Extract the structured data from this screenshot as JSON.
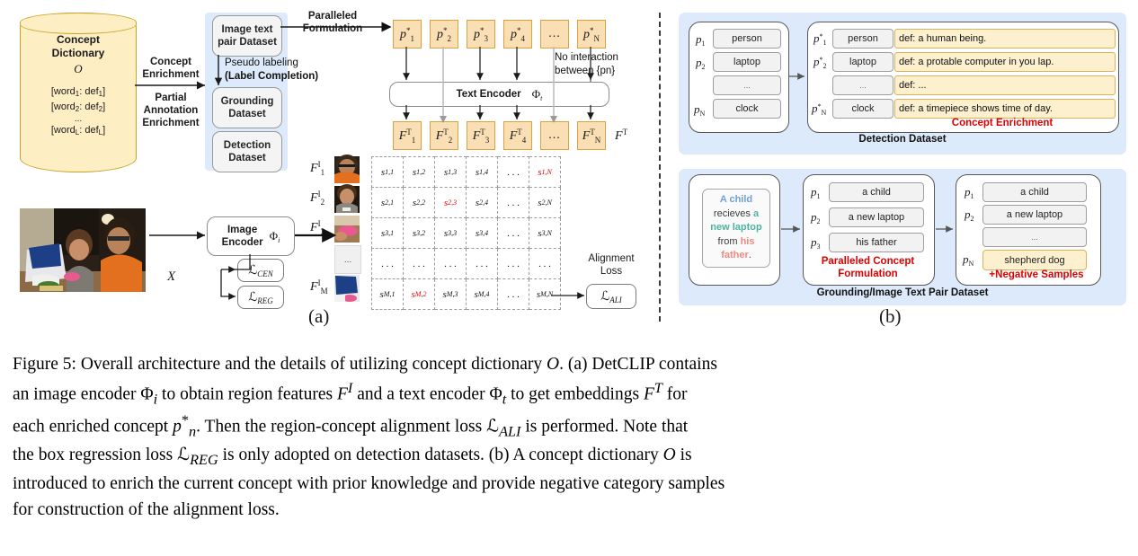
{
  "figure": {
    "label_a": "(a)",
    "label_b": "(b)",
    "caption_line1": "Figure 5: Overall architecture and the details of utilizing concept dictionary O. (a) DetCLIP contains",
    "caption_line2": "an image encoder Φi to obtain region features F I and a text encoder Φt to get embeddings F T for",
    "caption_line3": "each enriched concept p*n. Then the region-concept alignment loss LALI is performed. Note that",
    "caption_line4": "the box regression loss LREG is only adopted on detection datasets. (b) A concept dictionary O is",
    "caption_line5": "introduced to enrich the current concept with prior knowledge and provide negative category samples",
    "caption_line6": "for construction of the alignment loss."
  },
  "colors": {
    "dict_fill": "#fdeec4",
    "dict_stroke": "#c9a227",
    "panel_blue": "#ddeafb",
    "token_fill": "#fbdfb4",
    "token_stroke": "#d9a13f",
    "def_fill": "#fdf0cf",
    "accent_red": "#e00000",
    "phrase_blue": "#6f9fd8",
    "phrase_teal": "#4fb3a0",
    "phrase_red": "#f08a80"
  },
  "panel_a": {
    "dictionary": {
      "title_line1": "Concept",
      "title_line2": "Dictionary",
      "symbol": "O",
      "entry1": "[word1: def1]",
      "entry2": "[word2: def2]",
      "ellipsis": "...",
      "entryL": "[wordL: defL]"
    },
    "arrow_labels": {
      "concept_enrichment_l1": "Concept",
      "concept_enrichment_l2": "Enrichment",
      "partial_l1": "Partial",
      "partial_l2": "Annotation",
      "partial_l3": "Enrichment",
      "paralleled_l1": "Paralleled",
      "paralleled_l2": "Formulation",
      "pseudo_l1": "Pseudo labeling",
      "pseudo_l2": "(Label Completion)",
      "nointeract_l1": "No interaction",
      "nointeract_l2": "between {pn}"
    },
    "datasets": [
      {
        "line1": "Image text",
        "line2": "pair Dataset"
      },
      {
        "line1": "Grounding",
        "line2": "Dataset"
      },
      {
        "line1": "Detection",
        "line2": "Dataset"
      }
    ],
    "text_encoder": {
      "label": "Text Encoder",
      "symbol": "Φt"
    },
    "image_encoder": {
      "line1": "Image",
      "line2": "Encoder",
      "symbol": "Φi"
    },
    "image_input_label": "X",
    "concept_tokens": [
      "p*1",
      "p*2",
      "p*3",
      "p*4",
      "...",
      "p*N"
    ],
    "text_features": [
      "FT1",
      "FT2",
      "FT3",
      "FT4",
      "...",
      "FTN"
    ],
    "text_feature_group": "FT",
    "region_features": [
      "FI1",
      "FI2",
      "FI3",
      "...",
      "FIM"
    ],
    "losses": {
      "cen": "LCEN",
      "reg": "LREG",
      "ali": "LALI"
    },
    "alignment_loss_l1": "Alignment",
    "alignment_loss_l2": "Loss",
    "similarity_matrix": {
      "rows": [
        [
          "s1,1",
          "s1,2",
          "s1,3",
          "s1,4",
          "...",
          "s1,N"
        ],
        [
          "s2,1",
          "s2,2",
          "s2,3",
          "s2,4",
          "...",
          "s2,N"
        ],
        [
          "s3,1",
          "s3,2",
          "s3,3",
          "s3,4",
          "...",
          "s3,N"
        ],
        [
          "...",
          "...",
          "...",
          "...",
          "...",
          "..."
        ],
        [
          "sM,1",
          "sM,2",
          "sM,3",
          "sM,4",
          "...",
          "sM,N"
        ]
      ],
      "highlighted": [
        [
          0,
          5
        ],
        [
          1,
          2
        ],
        [
          4,
          1
        ]
      ]
    }
  },
  "panel_b": {
    "detection": {
      "group_label": "Detection Dataset",
      "enrichment_label": "Concept Enrichment",
      "raw": [
        {
          "idx": "p1",
          "concept": "person"
        },
        {
          "idx": "p2",
          "concept": "laptop"
        },
        {
          "idx": "",
          "concept": "..."
        },
        {
          "idx": "pN",
          "concept": "clock"
        }
      ],
      "enriched": [
        {
          "idx": "p*1",
          "concept": "person",
          "definition": "def: a human being."
        },
        {
          "idx": "p*2",
          "concept": "laptop",
          "definition": "def: a protable computer in you lap."
        },
        {
          "idx": "",
          "concept": "...",
          "definition": "def: ..."
        },
        {
          "idx": "p*N",
          "concept": "clock",
          "definition": "def: a timepiece shows time of day."
        }
      ]
    },
    "grounding": {
      "group_label": "Grounding/Image Text Pair Dataset",
      "formulation_l1": "Paralleled Concept",
      "formulation_l2": "Formulation",
      "negative_label": "+Negative Samples",
      "sentence_parts": [
        {
          "text": "A child",
          "color": "blue"
        },
        {
          "text": "recieves",
          "color": "dark"
        },
        {
          "text": "a",
          "color": "teal"
        },
        {
          "text": "new laptop",
          "color": "teal"
        },
        {
          "text": "from",
          "color": "dark"
        },
        {
          "text": "his",
          "color": "red"
        },
        {
          "text": "father",
          "color": "red"
        },
        {
          "text": ".",
          "color": "dark"
        }
      ],
      "concepts": [
        {
          "idx": "p1",
          "concept": "a child"
        },
        {
          "idx": "p2",
          "concept": "a new laptop"
        },
        {
          "idx": "p3",
          "concept": "his father"
        }
      ],
      "with_negatives": [
        {
          "idx": "p1",
          "concept": "a child",
          "neg": false
        },
        {
          "idx": "p2",
          "concept": "a new laptop",
          "neg": false
        },
        {
          "idx": "",
          "concept": "...",
          "neg": false
        },
        {
          "idx": "pN",
          "concept": "shepherd dog",
          "neg": true
        }
      ]
    }
  }
}
